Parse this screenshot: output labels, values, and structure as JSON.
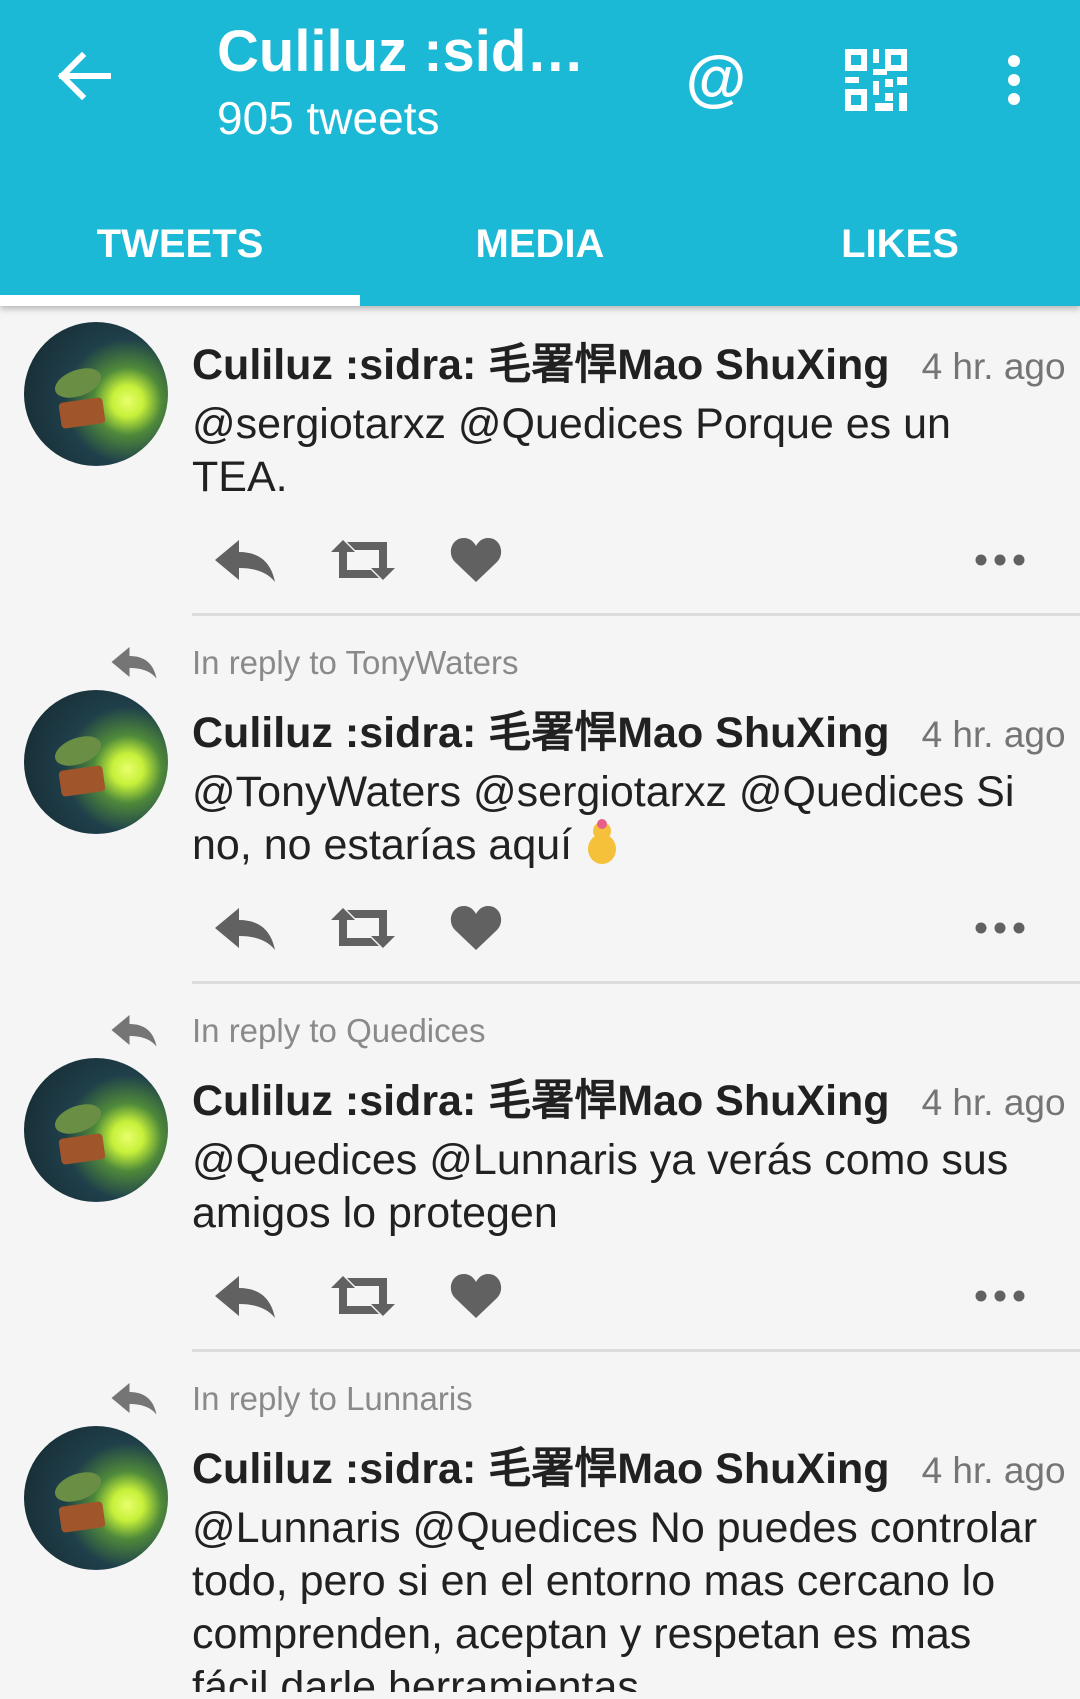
{
  "header": {
    "title": "Culiluz :sidr…",
    "subtitle": "905 tweets",
    "mention_label": "@",
    "accent_color": "#1bb9d6"
  },
  "tabs": [
    {
      "label": "TWEETS",
      "active": true
    },
    {
      "label": "MEDIA",
      "active": false
    },
    {
      "label": "LIKES",
      "active": false
    }
  ],
  "tweets": [
    {
      "reply_to": "",
      "name": "Culiluz :sidra: 毛署悍Mao ShuXing",
      "time": "4 hr. ago",
      "text": "@sergiotarxz @Quedices Porque es un TEA."
    },
    {
      "reply_to": "In reply to TonyWaters",
      "name": "Culiluz :sidra: 毛署悍Mao ShuXing",
      "time": "4 hr. ago",
      "text": "@TonyWaters @sergiotarxz @Quedices Si no, no estarías aquí"
    },
    {
      "reply_to": "In reply to Quedices",
      "name": "Culiluz :sidra: 毛署悍Mao ShuXing",
      "time": "4 hr. ago",
      "text": "@Quedices @Lunnaris ya verás como sus amigos lo protegen"
    },
    {
      "reply_to": "In reply to Lunnaris",
      "name": "Culiluz :sidra: 毛署悍Mao ShuXing",
      "time": "4 hr. ago",
      "text": "@Lunnaris @Quedices No puedes controlar todo, pero si en el entorno mas cercano lo comprenden, aceptan y respetan es mas fácil darle herramientas"
    }
  ],
  "icons": {
    "back": "arrow-left-icon",
    "qr": "qr-code-icon",
    "overflow": "more-vert-icon",
    "reply": "reply-icon",
    "retweet": "retweet-icon",
    "like": "heart-icon",
    "tweet_more": "more-horiz-icon"
  }
}
